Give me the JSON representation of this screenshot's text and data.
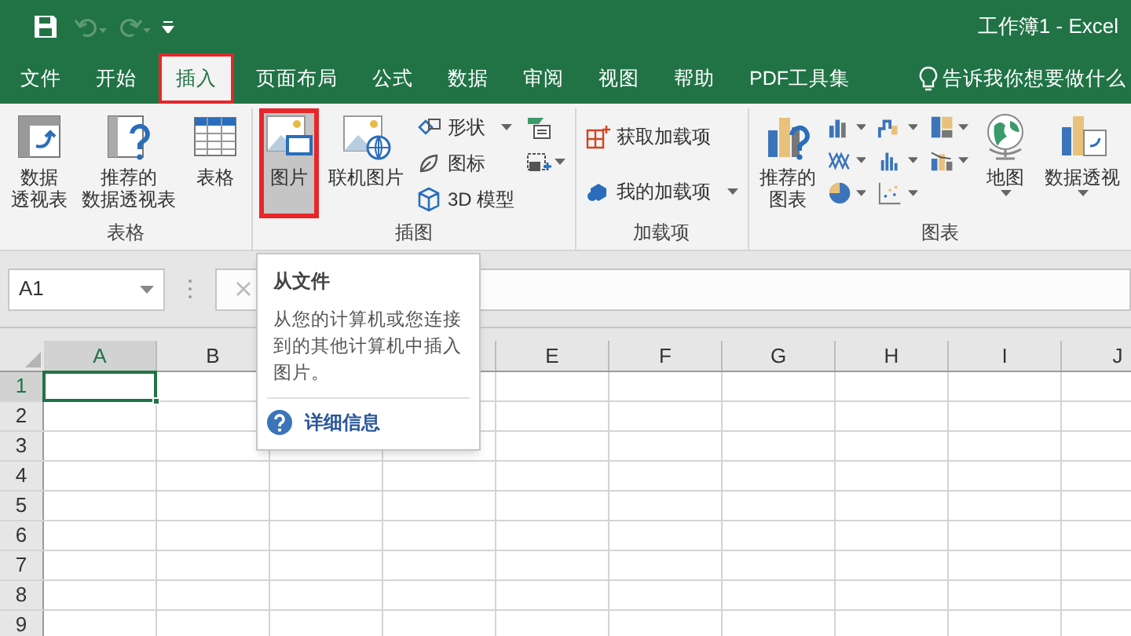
{
  "window": {
    "title": "工作簿1 - Excel"
  },
  "tabs": [
    {
      "label": "文件",
      "selected": false,
      "highlighted": false
    },
    {
      "label": "开始",
      "selected": false,
      "highlighted": false
    },
    {
      "label": "插入",
      "selected": true,
      "highlighted": true
    },
    {
      "label": "页面布局",
      "selected": false,
      "highlighted": false
    },
    {
      "label": "公式",
      "selected": false,
      "highlighted": false
    },
    {
      "label": "数据",
      "selected": false,
      "highlighted": false
    },
    {
      "label": "审阅",
      "selected": false,
      "highlighted": false
    },
    {
      "label": "视图",
      "selected": false,
      "highlighted": false
    },
    {
      "label": "帮助",
      "selected": false,
      "highlighted": false
    },
    {
      "label": "PDF工具集",
      "selected": false,
      "highlighted": false
    }
  ],
  "tell_me": {
    "placeholder": "告诉我你想要做什么"
  },
  "ribbon": {
    "groups": [
      {
        "label": "表格",
        "items": [
          {
            "kind": "large",
            "lines": [
              "数据",
              "透视表"
            ],
            "selected": false,
            "highlighted": false
          },
          {
            "kind": "large",
            "lines": [
              "推荐的",
              "数据透视表"
            ],
            "selected": false,
            "highlighted": false
          },
          {
            "kind": "large",
            "lines": [
              "表格"
            ],
            "selected": false,
            "highlighted": false
          }
        ]
      },
      {
        "label": "插图",
        "items": [
          {
            "kind": "large",
            "lines": [
              "图片"
            ],
            "selected": true,
            "highlighted": true
          },
          {
            "kind": "large",
            "lines": [
              "联机图片"
            ],
            "selected": false,
            "highlighted": false
          },
          {
            "kind": "stack",
            "entries": [
              {
                "label": "形状",
                "dropdown": true
              },
              {
                "label": "图标",
                "dropdown": false
              },
              {
                "label": "3D 模型",
                "dropdown": false
              }
            ]
          },
          {
            "kind": "iconstack",
            "entries": [
              {
                "dropdown": false
              },
              {
                "dropdown": true
              }
            ]
          }
        ]
      },
      {
        "label": "加载项",
        "items": [
          {
            "kind": "stack",
            "entries": [
              {
                "label": "获取加载项",
                "dropdown": false
              },
              {
                "label": "我的加载项",
                "dropdown": true
              }
            ]
          }
        ]
      },
      {
        "label": "图表",
        "items": [
          {
            "kind": "large",
            "lines": [
              "推荐的",
              "图表"
            ],
            "selected": false,
            "highlighted": false
          },
          {
            "kind": "chartgrid"
          },
          {
            "kind": "large",
            "lines": [
              "地图"
            ],
            "selected": false,
            "highlighted": false,
            "dropdown": true
          },
          {
            "kind": "large",
            "lines": [
              "数据透视"
            ],
            "selected": false,
            "highlighted": false,
            "dropdown": true
          }
        ]
      }
    ]
  },
  "name_box": {
    "value": "A1"
  },
  "columns": [
    {
      "label": "A",
      "selected": true
    },
    {
      "label": "B",
      "selected": false
    },
    {},
    {},
    {
      "label": "E",
      "selected": false
    },
    {
      "label": "F",
      "selected": false
    },
    {
      "label": "G",
      "selected": false
    },
    {
      "label": "H",
      "selected": false
    },
    {
      "label": "I",
      "selected": false
    },
    {
      "label": "J",
      "selected": false
    }
  ],
  "rows": [
    {
      "label": "1",
      "selected": true
    },
    {
      "label": "2",
      "selected": false
    },
    {
      "label": "3",
      "selected": false
    },
    {
      "label": "4",
      "selected": false
    },
    {
      "label": "5",
      "selected": false
    },
    {
      "label": "6",
      "selected": false
    },
    {
      "label": "7",
      "selected": false
    },
    {
      "label": "8",
      "selected": false
    },
    {
      "label": "9",
      "selected": false
    }
  ],
  "tooltip": {
    "title": "从文件",
    "body": "从您的计算机或您连接到的其他计算机中插入图片。",
    "link": "详细信息"
  }
}
